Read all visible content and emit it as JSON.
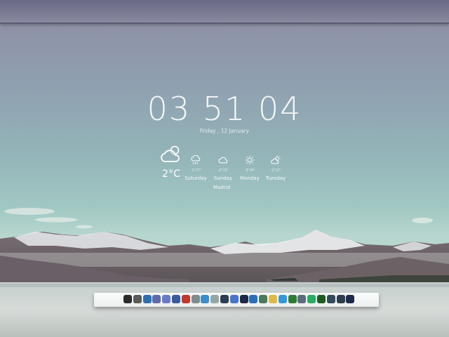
{
  "clock": {
    "time": "03 51 04",
    "date": "Friday , 12 January"
  },
  "weather": {
    "current": {
      "icon": "cloud-sun-icon",
      "temp": "2°C"
    },
    "city": "Madrid",
    "forecast": [
      {
        "day": "Saturday",
        "range": "-1°/7°",
        "icon": "cloud-rain-icon"
      },
      {
        "day": "Sunday",
        "range": "-2°/3°",
        "icon": "cloud-icon"
      },
      {
        "day": "Monday",
        "range": "-3°/4°",
        "icon": "sun-icon"
      },
      {
        "day": "Tuesday",
        "range": "-2°/2°",
        "icon": "cloud-sun-icon"
      }
    ]
  },
  "dock": {
    "items": [
      {
        "name": "dock-icon-1",
        "color": "#2b2b2b"
      },
      {
        "name": "dock-icon-2",
        "color": "#5a5a5a"
      },
      {
        "name": "dock-icon-3",
        "color": "#2d6fb3"
      },
      {
        "name": "dock-icon-4",
        "color": "#5e6aa8"
      },
      {
        "name": "dock-icon-5",
        "color": "#6a7ac8"
      },
      {
        "name": "dock-icon-6",
        "color": "#3a5a9a"
      },
      {
        "name": "dock-icon-7",
        "color": "#c0392b"
      },
      {
        "name": "dock-icon-8",
        "color": "#7f8c8d"
      },
      {
        "name": "dock-icon-9",
        "color": "#3c8dcc"
      },
      {
        "name": "dock-icon-10",
        "color": "#95a5a6"
      },
      {
        "name": "dock-icon-11",
        "color": "#2c3e50"
      },
      {
        "name": "dock-icon-12",
        "color": "#4a74c9"
      },
      {
        "name": "dock-icon-13",
        "color": "#1f2a44"
      },
      {
        "name": "dock-icon-14",
        "color": "#2c6fb8"
      },
      {
        "name": "dock-icon-15",
        "color": "#4a7a5a"
      },
      {
        "name": "dock-icon-16",
        "color": "#e0b84a"
      },
      {
        "name": "dock-icon-17",
        "color": "#3498db"
      },
      {
        "name": "dock-icon-18",
        "color": "#2e7d32"
      },
      {
        "name": "dock-icon-19",
        "color": "#5d6d7e"
      },
      {
        "name": "dock-icon-20",
        "color": "#27ae60"
      },
      {
        "name": "dock-icon-21",
        "color": "#1b5e20"
      },
      {
        "name": "dock-icon-22",
        "color": "#34495e"
      },
      {
        "name": "dock-icon-23",
        "color": "#2c3e50"
      },
      {
        "name": "dock-icon-24",
        "color": "#1e2b4a"
      }
    ]
  }
}
